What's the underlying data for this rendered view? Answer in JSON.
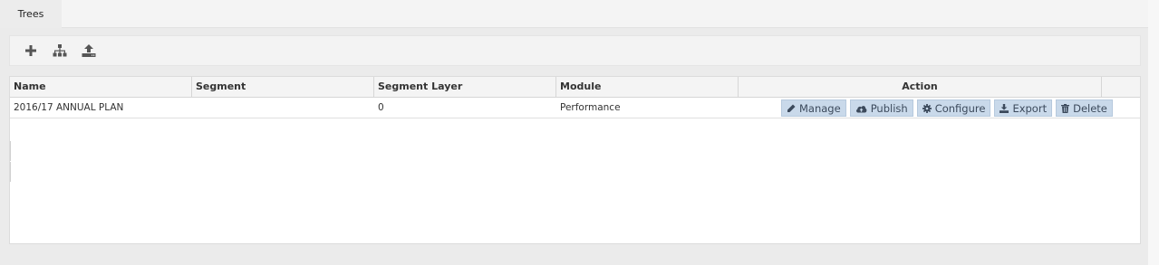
{
  "tabs": [
    {
      "label": "Trees",
      "active": true
    }
  ],
  "toolbar": {
    "icons": [
      {
        "name": "add-icon"
      },
      {
        "name": "hierarchy-icon"
      },
      {
        "name": "upload-icon"
      }
    ]
  },
  "grid": {
    "columns": [
      "Name",
      "Segment",
      "Segment Layer",
      "Module",
      "Action"
    ],
    "rows": [
      {
        "name": "2016/17 ANNUAL PLAN",
        "segment": "",
        "segment_layer": "0",
        "module": "Performance",
        "actions": [
          "Manage",
          "Publish",
          "Configure",
          "Export",
          "Delete"
        ]
      }
    ]
  },
  "colors": {
    "action_button_bg": "#c9d9ea",
    "action_button_text": "#3c4a5c",
    "icon_gray": "#555555"
  }
}
